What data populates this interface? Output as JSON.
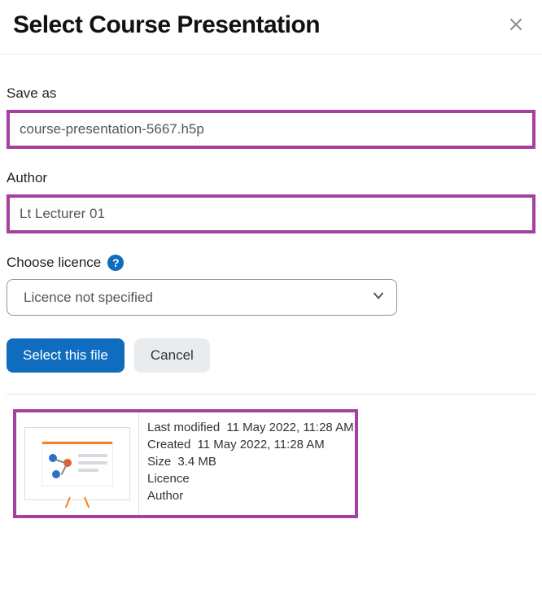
{
  "dialog": {
    "title": "Select Course Presentation",
    "close_aria": "Close"
  },
  "form": {
    "save_as_label": "Save as",
    "save_as_value": "course-presentation-5667.h5p",
    "author_label": "Author",
    "author_value": "Lt Lecturer 01",
    "licence_label": "Choose licence",
    "licence_selected": "Licence not specified"
  },
  "buttons": {
    "select_label": "Select this file",
    "cancel_label": "Cancel"
  },
  "file_meta": {
    "last_modified_label": "Last modified",
    "last_modified_value": "11 May 2022, 11:28 AM",
    "created_label": "Created",
    "created_value": "11 May 2022, 11:28 AM",
    "size_label": "Size",
    "size_value": "3.4 MB",
    "licence_label": "Licence",
    "licence_value": "",
    "author_label": "Author",
    "author_value": ""
  }
}
